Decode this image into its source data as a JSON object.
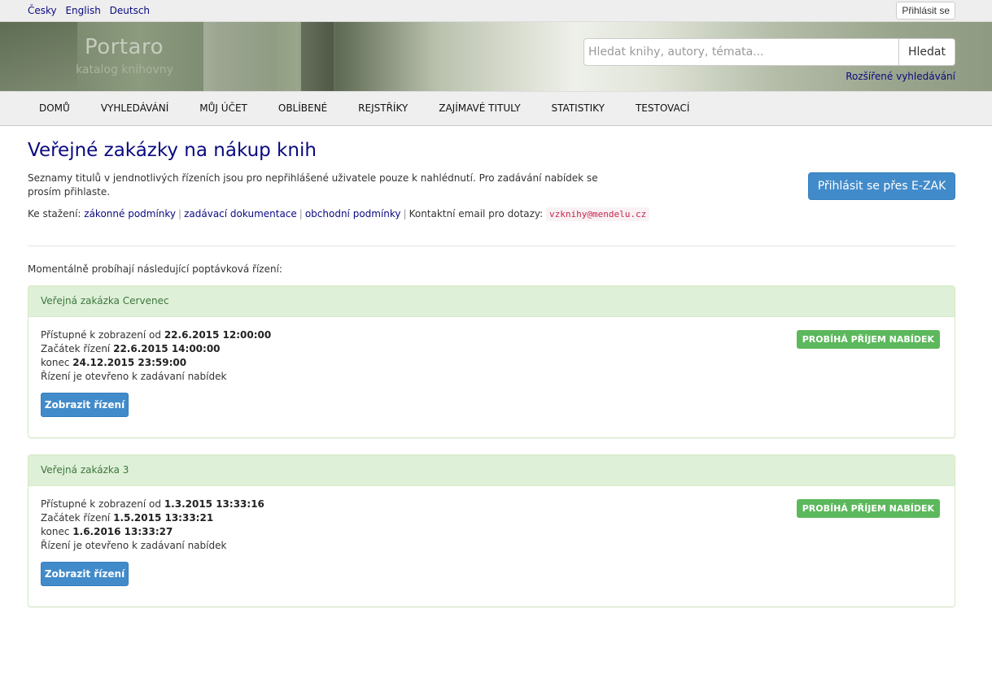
{
  "top": {
    "languages": [
      "Česky",
      "English",
      "Deutsch"
    ],
    "login_label": "Přihlásit se"
  },
  "header": {
    "logo_title": "Portaro",
    "logo_subtitle": "katalog knihovny",
    "search_placeholder": "Hledat knihy, autory, témata...",
    "search_button": "Hledat",
    "advanced_search": "Rozšířené vyhledávání"
  },
  "nav": {
    "items": [
      "DOMŮ",
      "VYHLEDÁVÁNÍ",
      "MŮJ ÚČET",
      "OBLÍBENÉ",
      "REJSTŘÍKY",
      "ZAJÍMAVÉ TITULY",
      "STATISTIKY",
      "TESTOVACÍ"
    ]
  },
  "page": {
    "title": "Veřejné zakázky na nákup knih",
    "intro": "Seznamy titulů v jendnotlivých řízeních jsou pro nepřihlášené uživatele pouze k nahlédnutí. Pro zadávání nabídek se prosím přihlaste.",
    "ezak_button": "Přihlásit se přes E-ZAK",
    "downloads_label": "Ke stažení:",
    "download_links": [
      "zákonné podmínky",
      "zadávací dokumentace",
      "obchodní podmínky"
    ],
    "contact_label": "Kontaktní email pro dotazy:",
    "contact_email": "vzknihy@mendelu.cz",
    "running_label": "Momentálně probíhají následující poptávková řízení:"
  },
  "tenders": [
    {
      "title": "Veřejná zakázka Cervenec",
      "status": "PROBÍHÁ PŘÍJEM NABÍDEK",
      "visible_from_label": "Přístupné k zobrazení od",
      "visible_from": "22.6.2015 12:00:00",
      "start_label": "Začátek řízení",
      "start": "22.6.2015 14:00:00",
      "end_label": "konec",
      "end": "24.12.2015 23:59:00",
      "note": "Řízení je otevřeno k zadávaní nabídek",
      "button": "Zobrazit řízení"
    },
    {
      "title": "Veřejná zakázka 3",
      "status": "PROBÍHÁ PŘÍJEM NABÍDEK",
      "visible_from_label": "Přístupné k zobrazení od",
      "visible_from": "1.3.2015 13:33:16",
      "start_label": "Začátek řízení",
      "start": "1.5.2015 13:33:21",
      "end_label": "konec",
      "end": "1.6.2016 13:33:27",
      "note": "Řízení je otevřeno k zadávaní nabídek",
      "button": "Zobrazit řízení"
    }
  ],
  "colors": {
    "link": "#0a0a80",
    "primary_button": "#428bca",
    "success_label": "#5cb85c",
    "panel_heading_bg": "#dff0d8",
    "panel_heading_text": "#3c763d"
  }
}
